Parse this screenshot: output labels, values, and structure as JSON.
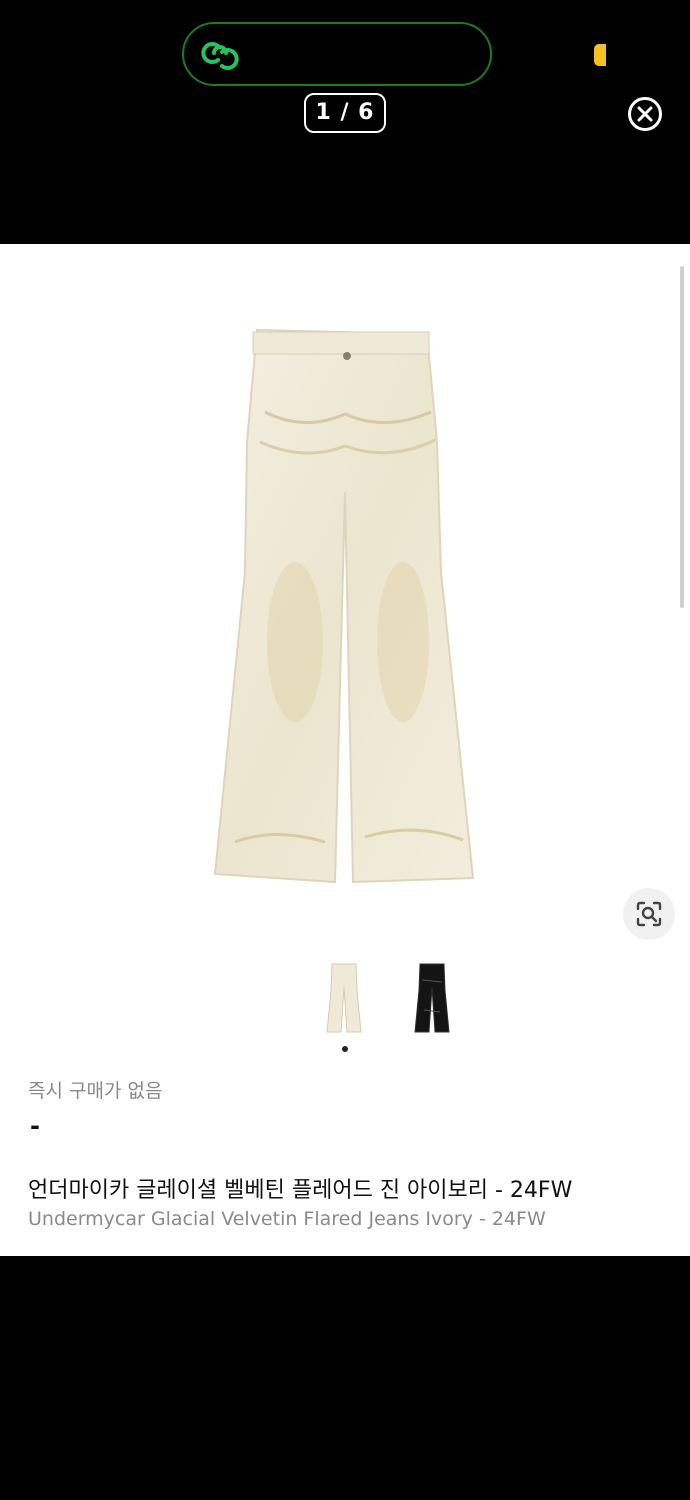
{
  "header": {
    "counter": "1 / 6",
    "accent_green": "#22c55e",
    "link_icon": "link-chain-icon",
    "close_icon": "close-circle-icon"
  },
  "product": {
    "no_instant_purchase": "즉시 구매가 없음",
    "price": "-",
    "name_ko": "언더마이카 글레이셜 벨베틴 플레어드 진 아이보리 - 24FW",
    "name_en": "Undermycar Glacial Velvetin Flared Jeans Ivory - 24FW",
    "image_color": "ivory",
    "variants": [
      "ivory",
      "black"
    ],
    "selected_variant": 0,
    "lens_icon": "visual-search-icon"
  }
}
